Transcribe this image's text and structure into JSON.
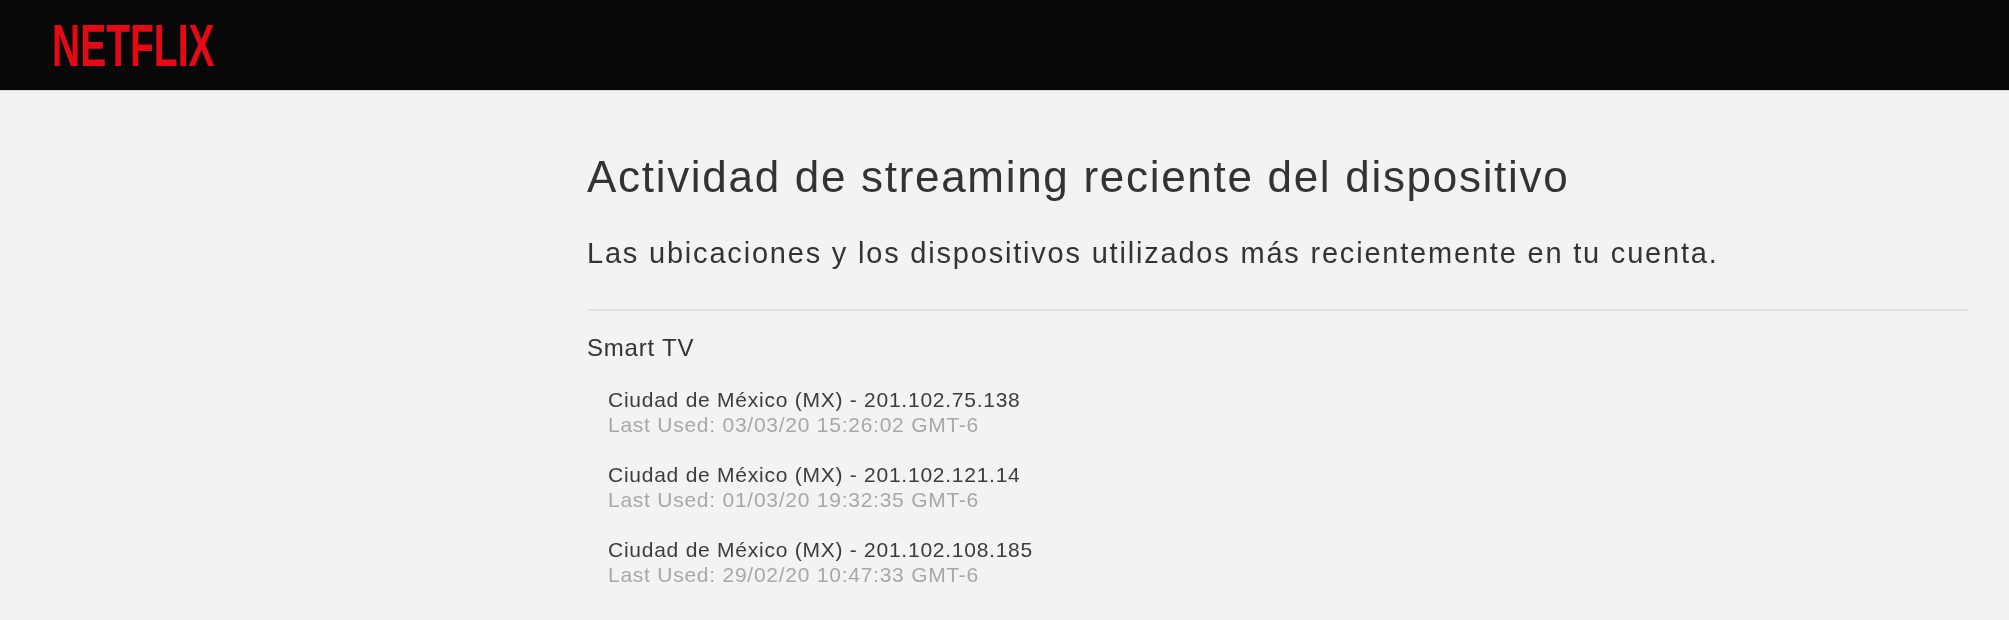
{
  "header": {
    "logo": "NETFLIX"
  },
  "page": {
    "title": "Actividad de streaming reciente del dispositivo",
    "subtitle": "Las ubicaciones y los dispositivos utilizados más recientemente en tu cuenta."
  },
  "devices": [
    {
      "type": "Smart TV",
      "sessions": [
        {
          "location": "Ciudad de México (MX) - 201.102.75.138",
          "last_used": "Last Used: 03/03/20 15:26:02 GMT-6"
        },
        {
          "location": "Ciudad de México (MX) - 201.102.121.14",
          "last_used": "Last Used: 01/03/20 19:32:35 GMT-6"
        },
        {
          "location": "Ciudad de México (MX) - 201.102.108.185",
          "last_used": "Last Used: 29/02/20 10:47:33 GMT-6"
        }
      ]
    }
  ]
}
